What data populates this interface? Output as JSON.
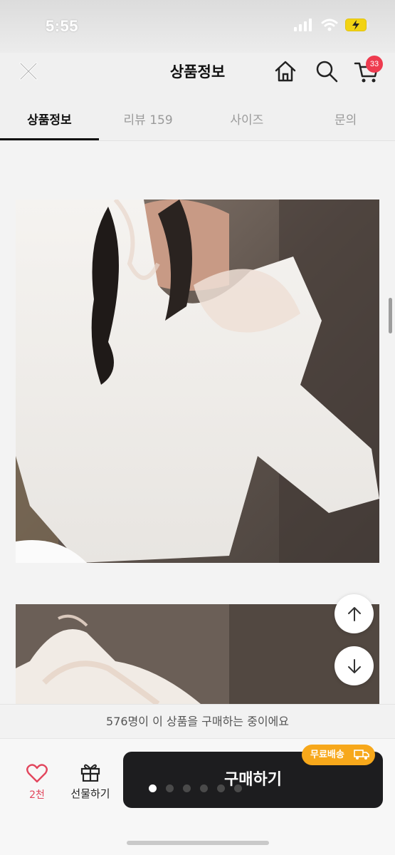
{
  "status_bar": {
    "time": "5:55"
  },
  "header": {
    "title": "상품정보",
    "cart_count": "33"
  },
  "tabs": [
    {
      "label": "상품정보",
      "active": true
    },
    {
      "label": "리뷰 159",
      "active": false
    },
    {
      "label": "사이즈",
      "active": false
    },
    {
      "label": "문의",
      "active": false
    }
  ],
  "notice": {
    "text": "576명이 이 상품을 구매하는 중이에요"
  },
  "bottom_bar": {
    "like_count": "2천",
    "gift_label": "선물하기",
    "buy_label": "구매하기",
    "free_shipping_label": "무료배송",
    "carousel_dots": 6,
    "carousel_active_index": 0
  },
  "colors": {
    "accent_pink": "#e2465d",
    "badge_red": "#ee3b4f",
    "buy_button": "#1d1d1f",
    "free_shipping": "#f7a81b"
  },
  "icons": [
    "close-icon",
    "home-icon",
    "search-icon",
    "cart-icon",
    "arrow-up-icon",
    "arrow-down-icon",
    "heart-icon",
    "gift-icon",
    "truck-icon"
  ]
}
